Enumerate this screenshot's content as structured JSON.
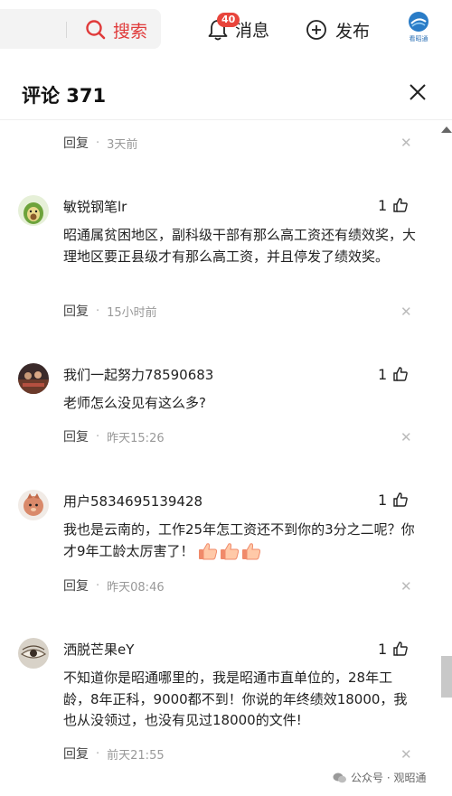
{
  "topbar": {
    "search_label": "搜索",
    "messages_label": "消息",
    "messages_badge": "40",
    "publish_label": "发布",
    "logo_text": "看昭通"
  },
  "comments_header": {
    "title": "评论 371"
  },
  "comments": [
    {
      "reply_label": "回复",
      "time": "3天前"
    },
    {
      "username": "敏锐钢笔lr",
      "likes": "1",
      "text": "昭通属贫困地区，副科级干部有那么高工资还有绩效奖，大理地区要正县级才有那么高工资，并且停发了绩效奖。",
      "reply_label": "回复",
      "time": "15小时前"
    },
    {
      "username": "我们一起努力78590683",
      "likes": "1",
      "text": "老师怎么没见有这么多?",
      "reply_label": "回复",
      "time": "昨天15:26"
    },
    {
      "username": "用户5834695139428",
      "likes": "1",
      "text": "我也是云南的，工作25年怎工资还不到你的3分之二呢？你才9年工龄太厉害了！",
      "reply_label": "回复",
      "time": "昨天08:46"
    },
    {
      "username": "洒脱芒果eY",
      "likes": "1",
      "text": "不知道你是昭通哪里的，我是昭通市直单位的，28年工龄，8年正科，9000都不到！你说的年终绩效18000，我也从没领过，也没有见过18000的文件!",
      "reply_label": "回复",
      "time": "前天21:55"
    }
  ],
  "watermark": "公众号 · 观昭通",
  "colors": {
    "accent_red": "#e03a3a",
    "badge_red": "#e8453c",
    "text": "#222222",
    "muted": "#999999"
  },
  "icons": [
    "search-icon",
    "bell-icon",
    "plus-circle-icon",
    "app-logo",
    "close-icon",
    "thumbs-up-icon",
    "dismiss-icon",
    "wechat-icon"
  ]
}
